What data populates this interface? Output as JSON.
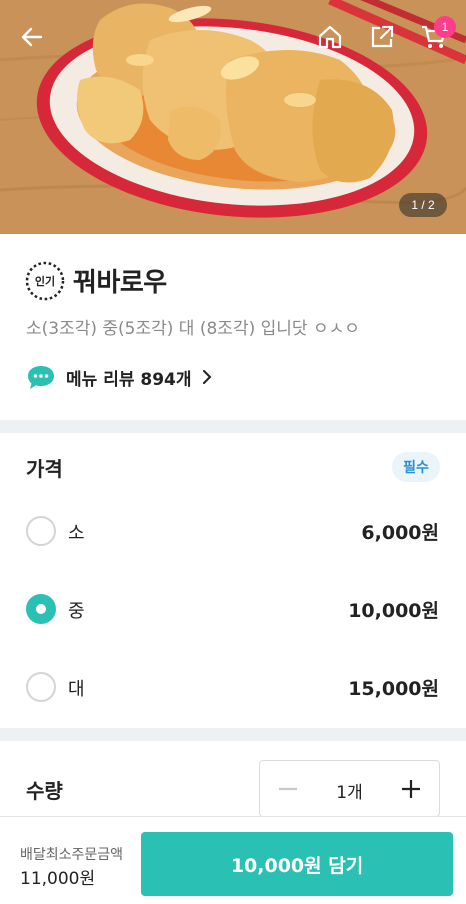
{
  "header": {
    "back_icon": "arrow-left-icon",
    "home_icon": "home-icon",
    "share_icon": "share-icon",
    "cart_icon": "cart-icon",
    "cart_count": "1",
    "photo_indicator": "1 / 2"
  },
  "menu": {
    "badge": "인기",
    "title": "꿔바로우",
    "description": "소(3조각) 중(5조각) 대 (8조각) 입니닷 ㅇㅅㅇ",
    "review_label": "메뉴 리뷰 894개"
  },
  "price_section": {
    "title": "가격",
    "required_label": "필수",
    "options": [
      {
        "label": "소",
        "price": "6,000원",
        "selected": false
      },
      {
        "label": "중",
        "price": "10,000원",
        "selected": true
      },
      {
        "label": "대",
        "price": "15,000원",
        "selected": false
      }
    ]
  },
  "quantity_section": {
    "title": "수량",
    "value": "1개"
  },
  "bottom_bar": {
    "min_order_label": "배달최소주문금액",
    "min_order_value": "11,000원",
    "add_button_label": "10,000원 담기"
  },
  "colors": {
    "accent": "#2bc0b4",
    "badge_pink": "#ff3d8b",
    "required_blue": "#2a8fd0"
  }
}
